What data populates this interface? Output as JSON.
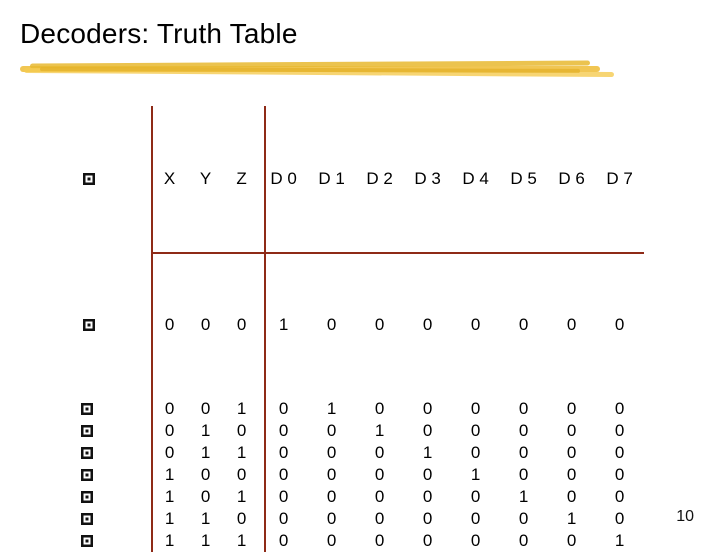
{
  "title": "Decoders: Truth Table",
  "page_number": "10",
  "columns": [
    "X",
    "Y",
    "Z",
    "D 0",
    "D 1",
    "D 2",
    "D 3",
    "D 4",
    "D 5",
    "D 6",
    "D 7"
  ],
  "rows": [
    [
      "0",
      "0",
      "0",
      "1",
      "0",
      "0",
      "0",
      "0",
      "0",
      "0",
      "0"
    ],
    [
      "0",
      "0",
      "1",
      "0",
      "1",
      "0",
      "0",
      "0",
      "0",
      "0",
      "0"
    ],
    [
      "0",
      "1",
      "0",
      "0",
      "0",
      "1",
      "0",
      "0",
      "0",
      "0",
      "0"
    ],
    [
      "0",
      "1",
      "1",
      "0",
      "0",
      "0",
      "1",
      "0",
      "0",
      "0",
      "0"
    ],
    [
      "1",
      "0",
      "0",
      "0",
      "0",
      "0",
      "0",
      "1",
      "0",
      "0",
      "0"
    ],
    [
      "1",
      "0",
      "1",
      "0",
      "0",
      "0",
      "0",
      "0",
      "1",
      "0",
      "0"
    ],
    [
      "1",
      "1",
      "0",
      "0",
      "0",
      "0",
      "0",
      "0",
      "0",
      "1",
      "0"
    ],
    [
      "1",
      "1",
      "1",
      "0",
      "0",
      "0",
      "0",
      "0",
      "0",
      "0",
      "1"
    ]
  ],
  "chart_data": {
    "type": "table",
    "title": "Decoders: Truth Table",
    "columns": [
      "X",
      "Y",
      "Z",
      "D0",
      "D1",
      "D2",
      "D3",
      "D4",
      "D5",
      "D6",
      "D7"
    ],
    "rows": [
      [
        0,
        0,
        0,
        1,
        0,
        0,
        0,
        0,
        0,
        0,
        0
      ],
      [
        0,
        0,
        1,
        0,
        1,
        0,
        0,
        0,
        0,
        0,
        0
      ],
      [
        0,
        1,
        0,
        0,
        0,
        1,
        0,
        0,
        0,
        0,
        0
      ],
      [
        0,
        1,
        1,
        0,
        0,
        0,
        1,
        0,
        0,
        0,
        0
      ],
      [
        1,
        0,
        0,
        0,
        0,
        0,
        0,
        1,
        0,
        0,
        0
      ],
      [
        1,
        0,
        1,
        0,
        0,
        0,
        0,
        0,
        1,
        0,
        0
      ],
      [
        1,
        1,
        0,
        0,
        0,
        0,
        0,
        0,
        0,
        1,
        0
      ],
      [
        1,
        1,
        1,
        0,
        0,
        0,
        0,
        0,
        0,
        0,
        1
      ]
    ]
  }
}
